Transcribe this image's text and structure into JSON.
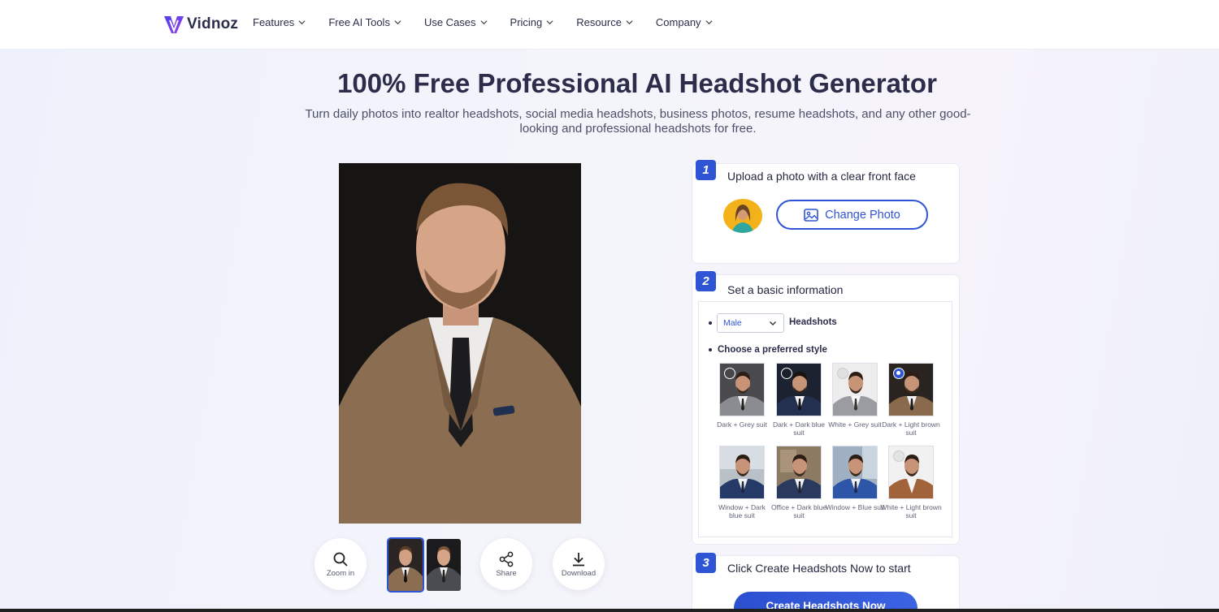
{
  "brand": {
    "name": "Vidnoz",
    "accent": "#2f55d4",
    "logo_colors": [
      "#5b3ff2",
      "#8a3ee8"
    ]
  },
  "nav": [
    {
      "label": "Features"
    },
    {
      "label": "Free AI Tools"
    },
    {
      "label": "Use Cases"
    },
    {
      "label": "Pricing"
    },
    {
      "label": "Resource"
    },
    {
      "label": "Company"
    }
  ],
  "hero": {
    "title": "100% Free Professional AI Headshot Generator",
    "subtitle": "Turn daily photos into realtor headshots, social media headshots, business photos, resume headshots, and any other good-looking and professional headshots for free."
  },
  "preview": {
    "tools": {
      "zoom": "Zoom in",
      "share": "Share",
      "download": "Download"
    },
    "icons": [
      "search-icon",
      "share-icon",
      "download-icon"
    ]
  },
  "steps": {
    "step1": {
      "num": "1",
      "title": "Upload a photo with a clear front face",
      "button": "Change Photo"
    },
    "step2": {
      "num": "2",
      "title": "Set a basic information",
      "gender": "Male",
      "gender_suffix": "Headshots",
      "style_heading": "Choose a preferred style",
      "selected_style": "Dark + Light brown suit",
      "styles": [
        "Dark + Grey suit",
        "Dark + Dark blue suit",
        "White + Grey suit",
        "Dark + Light brown suit",
        "Window + Dark blue suit",
        "Office + Dark blue suit",
        "Window + Blue suit",
        "White + Light brown suit"
      ]
    },
    "step3": {
      "num": "3",
      "title": "Click Create Headshots Now to start",
      "button": "Create Headshots Now"
    }
  }
}
